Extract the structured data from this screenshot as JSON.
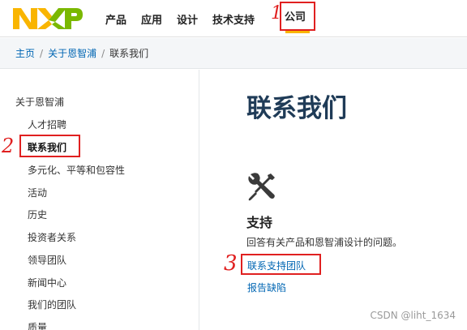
{
  "header": {
    "logo_text": "NXP",
    "nav": [
      "产品",
      "应用",
      "设计",
      "技术支持",
      "公司"
    ],
    "active_nav": "公司"
  },
  "breadcrumb": {
    "items": [
      "主页",
      "关于恩智浦",
      "联系我们"
    ]
  },
  "sidebar": {
    "root": "关于恩智浦",
    "items": [
      "人才招聘",
      "联系我们",
      "多元化、平等和包容性",
      "活动",
      "历史",
      "投资者关系",
      "领导团队",
      "新闻中心",
      "我们的团队",
      "质量"
    ],
    "active": "联系我们"
  },
  "main": {
    "title": "联系我们",
    "icon": "tools-icon",
    "section_title": "支持",
    "section_desc": "回答有关产品和恩智浦设计的问题。",
    "links": [
      "联系支持团队",
      "报告缺陷"
    ]
  },
  "annotations": [
    "1",
    "2",
    "3"
  ],
  "watermark": "CSDN @liht_1634",
  "colors": {
    "brand_yellow": "#f9b500",
    "brand_blue": "#7ab800",
    "link": "#0066b3",
    "title": "#1f3b57",
    "annotation": "#e02020"
  }
}
